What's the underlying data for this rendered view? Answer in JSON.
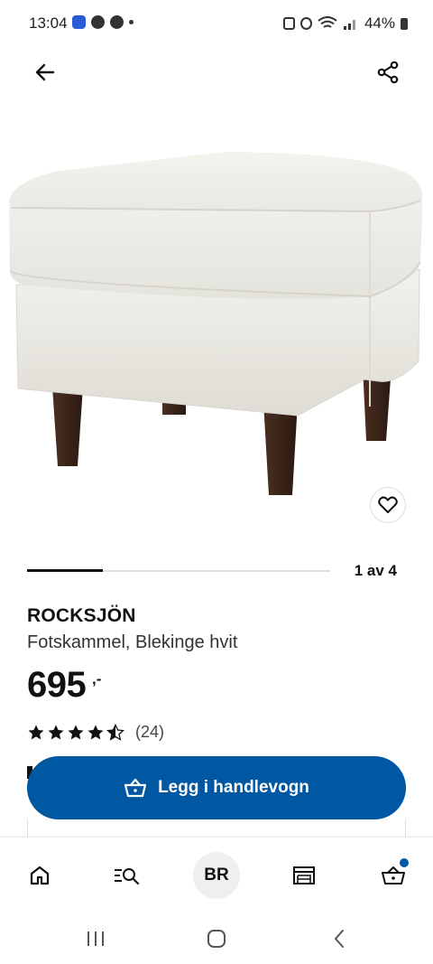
{
  "status_bar": {
    "time": "13:04",
    "battery": "44%"
  },
  "header": {
    "back_icon": "arrow-left-icon",
    "share_icon": "share-icon"
  },
  "carousel": {
    "page_indicator": "1 av 4",
    "current": 1,
    "total": 4,
    "progress_fraction": 0.25
  },
  "product": {
    "name": "ROCKSJÖN",
    "description": "Fotskammel, Blekinge hvit",
    "price": "695",
    "price_suffix": ",-",
    "rating_value": 4.5,
    "rating_max": 5,
    "rating_count": "(24)"
  },
  "actions": {
    "add_to_cart_label": "Legg i handlevogn",
    "favorite_icon": "heart-icon"
  },
  "bottom_nav": {
    "items": [
      {
        "icon": "home-icon"
      },
      {
        "icon": "search-list-icon"
      },
      {
        "label": "BR"
      },
      {
        "icon": "store-icon"
      },
      {
        "icon": "cart-icon",
        "badge": true
      }
    ]
  },
  "colors": {
    "accent": "#0058a3",
    "text": "#111111"
  }
}
